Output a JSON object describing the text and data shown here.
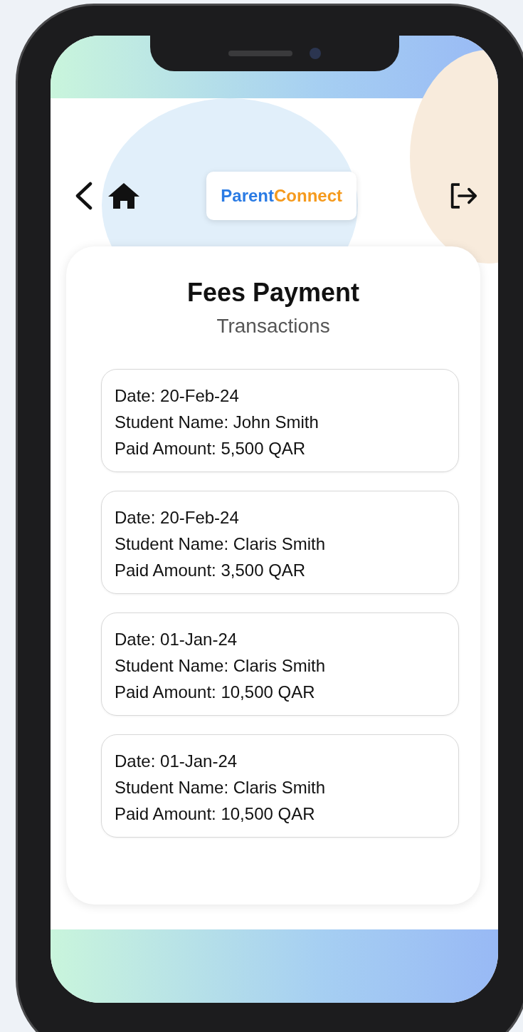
{
  "header": {
    "logo": [
      {
        "text": "Parent",
        "kind": "primary"
      },
      {
        "text": "Connect",
        "kind": "accent"
      }
    ]
  },
  "page": {
    "title": "Fees Payment",
    "subtitle": "Transactions"
  },
  "transactions": [
    {
      "lines": [
        "Date: 20-Feb-24",
        "Student Name: John Smith",
        "Paid Amount: 5,500 QAR"
      ]
    },
    {
      "lines": [
        "Date: 20-Feb-24",
        "Student Name: Claris Smith",
        "Paid Amount: 3,500 QAR"
      ]
    },
    {
      "lines": [
        "Date: 01-Jan-24",
        "Student Name: Claris Smith",
        "Paid Amount: 10,500 QAR"
      ]
    },
    {
      "lines": [
        "Date: 01-Jan-24",
        "Student Name: Claris Smith",
        "Paid Amount: 10,500 QAR"
      ]
    }
  ]
}
